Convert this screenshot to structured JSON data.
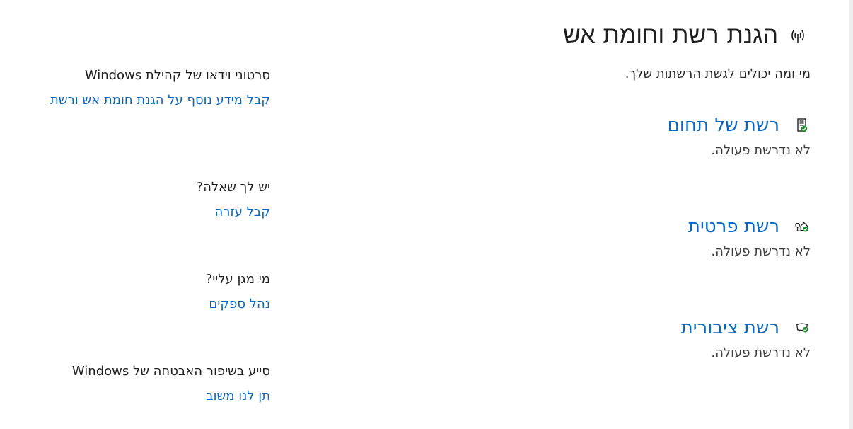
{
  "header": {
    "title": "הגנת רשת וחומת אש",
    "subtitle": "מי ומה יכולים לגשת הרשתות שלך."
  },
  "networks": [
    {
      "name": "רשת של תחום",
      "status": "לא נדרשת פעולה.",
      "icon": "domain-network-icon"
    },
    {
      "name": "רשת פרטית",
      "status": "לא נדרשת פעולה.",
      "icon": "private-network-icon"
    },
    {
      "name": "רשת ציבורית",
      "status": "לא נדרשת פעולה.",
      "icon": "public-network-icon"
    }
  ],
  "side": {
    "videos": {
      "heading": "סרטוני וידאו של קהילת Windows",
      "link": "קבל מידע נוסף על הגנת חומת אש ורשת"
    },
    "question": {
      "heading": "יש לך שאלה?",
      "link": "קבל עזרה"
    },
    "protecting": {
      "heading": "מי מגן עליי?",
      "link": "נהל ספקים"
    },
    "improve": {
      "heading": "סייע בשיפור האבטחה של Windows",
      "link": "תן לנו משוב"
    }
  },
  "colors": {
    "link": "#0a67c2",
    "ok_badge": "#1e8c2f"
  }
}
